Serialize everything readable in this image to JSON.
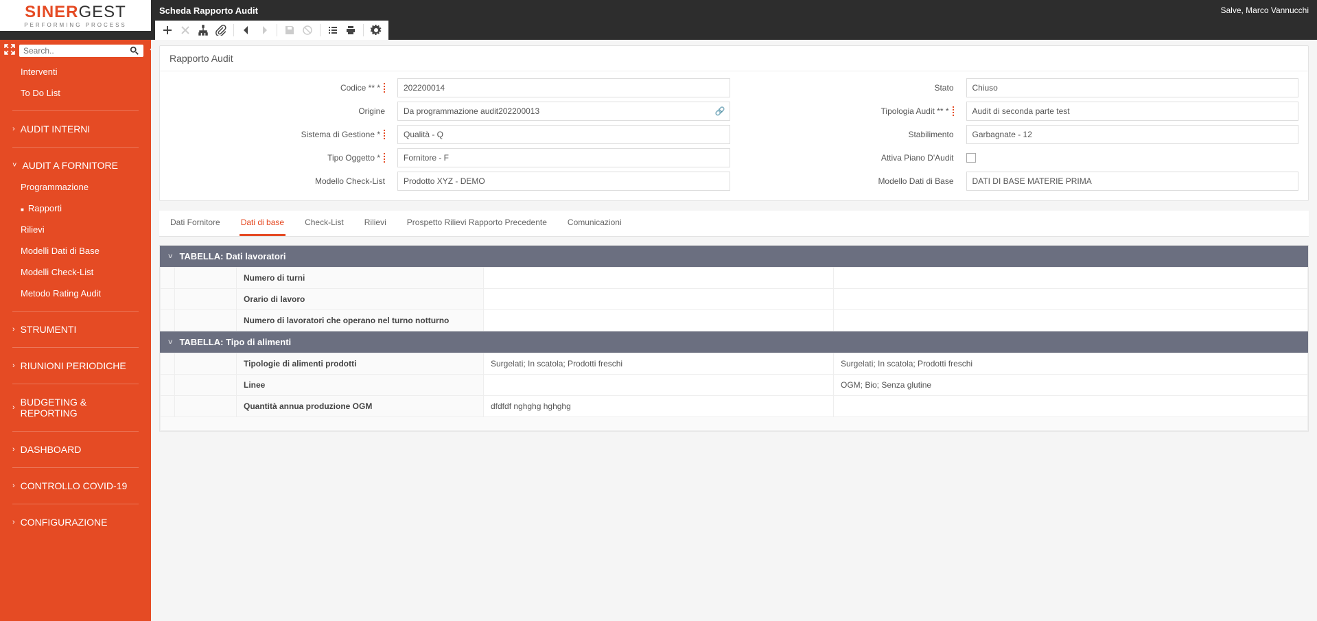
{
  "logo": {
    "part1": "SINER",
    "part2": "GEST",
    "sub": "PERFORMING PROCESS"
  },
  "header": {
    "page_title": "Scheda Rapporto Audit",
    "greeting": "Salve, Marco Vannucchi"
  },
  "search": {
    "placeholder": "Search.."
  },
  "sidebar": {
    "top_items": [
      "Interventi",
      "To Do List"
    ],
    "sections": [
      {
        "label": "AUDIT INTERNI",
        "expanded": false,
        "chev": "›"
      },
      {
        "label": "AUDIT A FORNITORE",
        "expanded": true,
        "chev": "˅",
        "children": [
          "Programmazione",
          "Rapporti",
          "Rilievi",
          "Modelli Dati di Base",
          "Modelli Check-List",
          "Metodo Rating Audit"
        ],
        "active_child": "Rapporti"
      },
      {
        "label": "STRUMENTI",
        "expanded": false,
        "chev": "›"
      },
      {
        "label": "RIUNIONI PERIODICHE",
        "expanded": false,
        "chev": "›"
      },
      {
        "label": "BUDGETING & REPORTING",
        "expanded": false,
        "chev": "›"
      },
      {
        "label": "DASHBOARD",
        "expanded": false,
        "chev": "›"
      },
      {
        "label": "CONTROLLO COVID-19",
        "expanded": false,
        "chev": "›"
      },
      {
        "label": "CONFIGURAZIONE",
        "expanded": false,
        "chev": "›"
      }
    ]
  },
  "panel": {
    "title": "Rapporto Audit",
    "fields": {
      "codice_label": "Codice ** *",
      "codice_value": "202200014",
      "stato_label": "Stato",
      "stato_value": "Chiuso",
      "origine_label": "Origine",
      "origine_value": "Da programmazione audit202200013",
      "tipologia_label": "Tipologia Audit ** *",
      "tipologia_value": "Audit di seconda parte test",
      "sistema_label": "Sistema di Gestione *",
      "sistema_value": "Qualità - Q",
      "stabilimento_label": "Stabilimento",
      "stabilimento_value": "Garbagnate - 12",
      "tipo_oggetto_label": "Tipo Oggetto *",
      "tipo_oggetto_value": "Fornitore - F",
      "piano_label": "Attiva Piano D'Audit",
      "modello_cl_label": "Modello Check-List",
      "modello_cl_value": "Prodotto XYZ - DEMO",
      "modello_db_label": "Modello Dati di Base",
      "modello_db_value": "DATI DI BASE MATERIE PRIMA"
    }
  },
  "tabs": [
    "Dati Fornitore",
    "Dati di base",
    "Check-List",
    "Rilievi",
    "Prospetto Rilievi Rapporto Precedente",
    "Comunicazioni"
  ],
  "active_tab": "Dati di base",
  "tables": [
    {
      "title": "TABELLA: Dati lavoratori",
      "rows": [
        {
          "label": "Numero di turni",
          "v1": "",
          "v2": ""
        },
        {
          "label": "Orario di lavoro",
          "v1": "",
          "v2": ""
        },
        {
          "label": "Numero di lavoratori che operano nel turno notturno",
          "v1": "",
          "v2": ""
        }
      ]
    },
    {
      "title": "TABELLA: Tipo di alimenti",
      "rows": [
        {
          "label": "Tipologie di alimenti prodotti",
          "v1": "Surgelati; In scatola; Prodotti freschi",
          "v2": "Surgelati; In scatola; Prodotti freschi"
        },
        {
          "label": "Linee",
          "v1": "",
          "v2": "OGM; Bio; Senza glutine"
        },
        {
          "label": "Quantità annua produzione OGM",
          "v1": "dfdfdf nghghg hghghg",
          "v2": ""
        }
      ]
    }
  ]
}
